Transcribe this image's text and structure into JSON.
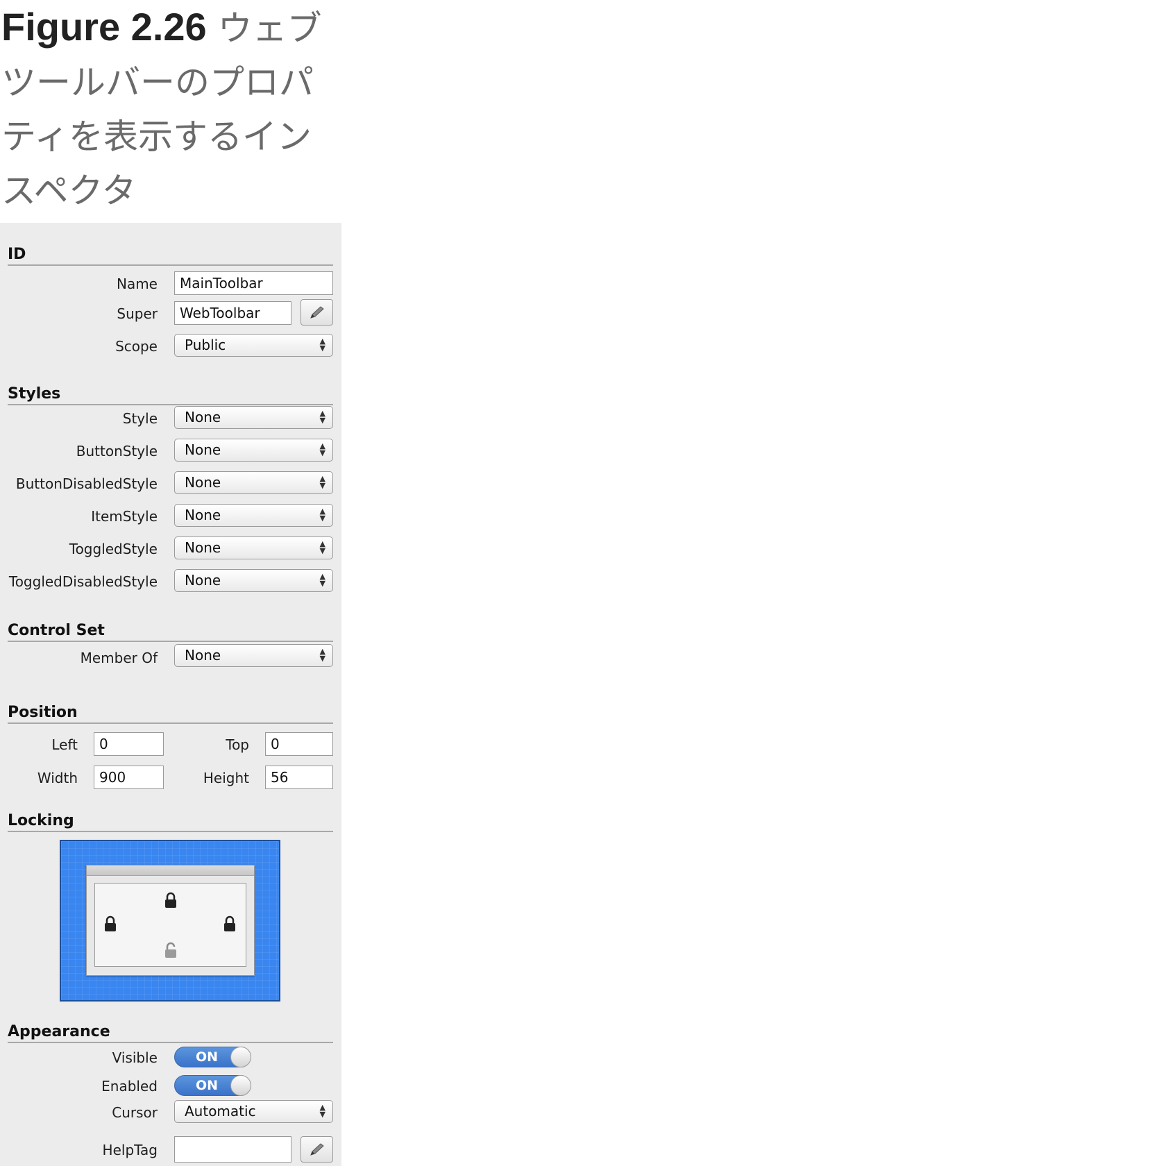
{
  "caption": {
    "figure_label": "Figure 2.26",
    "text": "ウェブツールバーのプロパティを表示するインスペクタ"
  },
  "sections": {
    "id": "ID",
    "styles": "Styles",
    "control_set": "Control Set",
    "position": "Position",
    "locking": "Locking",
    "appearance": "Appearance"
  },
  "id_section": {
    "name_label": "Name",
    "name_value": "MainToolbar",
    "super_label": "Super",
    "super_value": "WebToolbar",
    "scope_label": "Scope",
    "scope_value": "Public"
  },
  "styles_section": {
    "rows": [
      {
        "label": "Style",
        "value": "None"
      },
      {
        "label": "ButtonStyle",
        "value": "None"
      },
      {
        "label": "ButtonDisabledStyle",
        "value": "None"
      },
      {
        "label": "ItemStyle",
        "value": "None"
      },
      {
        "label": "ToggledStyle",
        "value": "None"
      },
      {
        "label": "ToggledDisabledStyle",
        "value": "None"
      }
    ]
  },
  "control_set_section": {
    "member_of_label": "Member Of",
    "member_of_value": "None"
  },
  "position_section": {
    "left_label": "Left",
    "left_value": "0",
    "top_label": "Top",
    "top_value": "0",
    "width_label": "Width",
    "width_value": "900",
    "height_label": "Height",
    "height_value": "56"
  },
  "locking_section": {
    "lock_top": "locked",
    "lock_left": "locked",
    "lock_right": "locked",
    "lock_bottom": "unlocked",
    "accent_color": "#3a86f0"
  },
  "appearance_section": {
    "visible_label": "Visible",
    "visible_state": "ON",
    "enabled_label": "Enabled",
    "enabled_state": "ON",
    "cursor_label": "Cursor",
    "cursor_value": "Automatic",
    "helptag_label": "HelpTag",
    "helptag_value": ""
  },
  "icons": {
    "edit": "pencil-icon",
    "popup": "up-down-arrows-icon",
    "lock": "padlock-icon"
  }
}
